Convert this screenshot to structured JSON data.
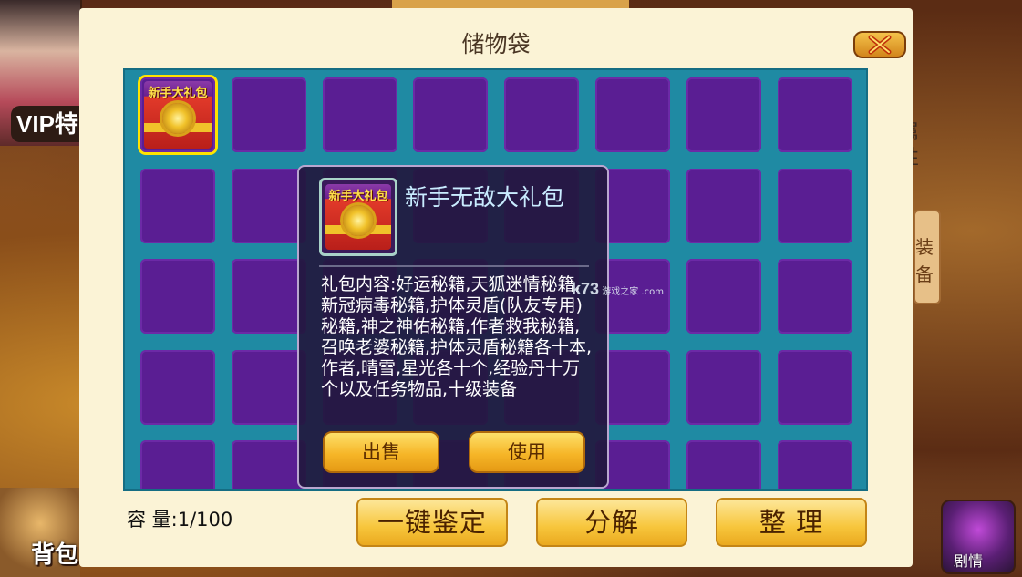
{
  "background": {
    "vip_label": "VIP特",
    "left_bottom_label": "背包",
    "right_side_text": "属性",
    "right_deco_text": "装备",
    "story_button_label": "剧情"
  },
  "dialog": {
    "title": "储物袋",
    "close_icon": "close-x-icon",
    "grid": {
      "columns": 8,
      "visible_rows": 5,
      "items": [
        {
          "slot": 0,
          "name": "新手大礼包",
          "icon_text": "新手大礼包",
          "selected": true
        }
      ]
    },
    "tooltip": {
      "item_name": "新手无敌大礼包",
      "icon_text": "新手大礼包",
      "description": "礼包内容:好运秘籍,天狐迷情秘籍,新冠病毒秘籍,护体灵盾(队友专用)秘籍,神之神佑秘籍,作者救我秘籍,召唤老婆秘籍,护体灵盾秘籍各十本,作者,晴雪,星光各十个,经验丹十万个以及任务物品,十级装备",
      "sell_label": "出售",
      "use_label": "使用"
    },
    "capacity_label": "容 量:1/100",
    "buttons": {
      "identify_label": "一键鉴定",
      "decompose_label": "分解",
      "sort_label": "整 理"
    },
    "watermark": {
      "logo": "k73",
      "text": "游戏之家",
      "domain": ".com"
    }
  },
  "colors": {
    "dialog_bg": "#fbf3d6",
    "grid_frame": "#1f8aa3",
    "slot": "#5a1e93",
    "selected_outline": "#ffe300",
    "gold_button": "#f7c63c"
  }
}
